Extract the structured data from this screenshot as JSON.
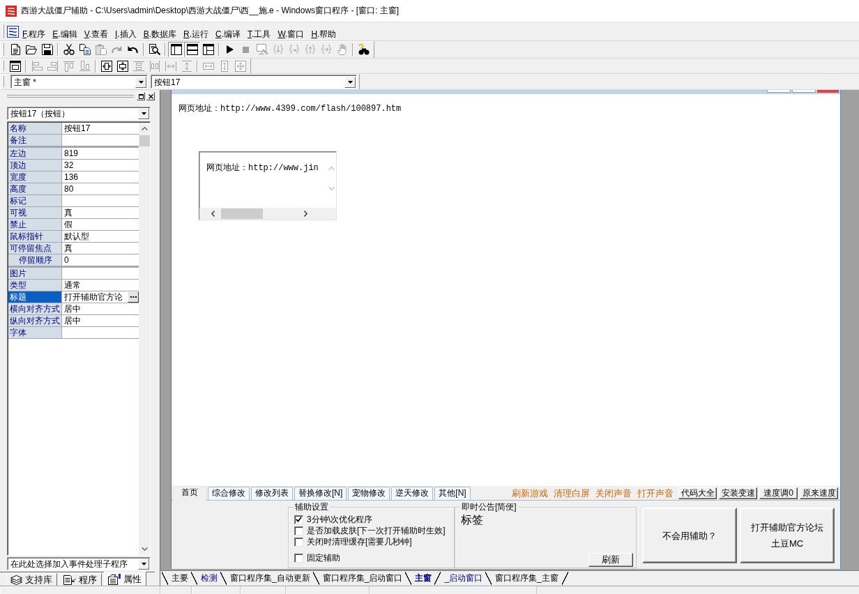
{
  "window": {
    "title": "西游大战僵尸辅助 - C:\\Users\\admin\\Desktop\\西游大战僵尸\\西__施.e - Windows窗口程序 - [窗口: 主窗]"
  },
  "menu": [
    "F.程序",
    "E.编辑",
    "V.查看",
    "I.插入",
    "B.数据库",
    "R.运行",
    "C.编译",
    "T.工具",
    "W.窗口",
    "H.帮助"
  ],
  "toolbars": [
    {
      "groups": [
        [
          {
            "kind": "new",
            "disabled": false,
            "pressed": false
          },
          {
            "kind": "open",
            "disabled": false,
            "pressed": false
          },
          {
            "kind": "save",
            "disabled": false,
            "pressed": false
          }
        ],
        [
          {
            "kind": "cut",
            "disabled": false,
            "pressed": false
          },
          {
            "kind": "copy",
            "disabled": false,
            "pressed": false
          },
          {
            "kind": "paste",
            "disabled": true,
            "pressed": false
          },
          {
            "kind": "redo",
            "disabled": true,
            "pressed": false
          },
          {
            "kind": "undo",
            "disabled": false,
            "pressed": false
          }
        ],
        [
          {
            "kind": "find",
            "disabled": false,
            "pressed": false
          }
        ],
        [
          {
            "kind": "layout-left",
            "disabled": false,
            "pressed": true
          },
          {
            "kind": "layout-top",
            "disabled": false,
            "pressed": true
          },
          {
            "kind": "layout-split",
            "disabled": false,
            "pressed": false
          }
        ],
        [
          {
            "kind": "run",
            "disabled": false,
            "pressed": false
          },
          {
            "kind": "stop",
            "disabled": true,
            "pressed": false
          },
          {
            "kind": "monitor",
            "disabled": true,
            "pressed": false
          },
          {
            "kind": "step-into",
            "disabled": true,
            "pressed": false
          },
          {
            "kind": "step-over",
            "disabled": true,
            "pressed": false
          },
          {
            "kind": "step-out",
            "disabled": true,
            "pressed": false
          },
          {
            "kind": "run-to",
            "disabled": true,
            "pressed": false
          },
          {
            "kind": "hand",
            "disabled": true,
            "pressed": false
          }
        ],
        [
          {
            "kind": "help",
            "disabled": false,
            "pressed": false
          }
        ]
      ]
    },
    {
      "groups": [
        [
          {
            "kind": "form",
            "disabled": false,
            "pressed": false
          }
        ],
        [
          {
            "kind": "align-left",
            "disabled": true,
            "pressed": false
          },
          {
            "kind": "align-right",
            "disabled": true,
            "pressed": false
          },
          {
            "kind": "align-top",
            "disabled": true,
            "pressed": false
          },
          {
            "kind": "align-bottom",
            "disabled": true,
            "pressed": false
          }
        ],
        [
          {
            "kind": "center-horizontal",
            "disabled": false,
            "pressed": false
          },
          {
            "kind": "center-vertical",
            "disabled": false,
            "pressed": false
          },
          {
            "kind": "stack-vertical",
            "disabled": true,
            "pressed": false
          },
          {
            "kind": "stack-horizontal",
            "disabled": true,
            "pressed": false
          },
          {
            "kind": "spread-horizontal",
            "disabled": true,
            "pressed": false
          },
          {
            "kind": "spread-vertical",
            "disabled": true,
            "pressed": false
          }
        ],
        [
          {
            "kind": "same-width",
            "disabled": true,
            "pressed": false
          },
          {
            "kind": "same-height",
            "disabled": true,
            "pressed": false
          },
          {
            "kind": "same-size",
            "disabled": true,
            "pressed": false
          }
        ]
      ]
    }
  ],
  "selectors": {
    "window_combo": "主窗 *",
    "control_combo": "按钮17"
  },
  "property_panel": {
    "object_combo": "按钮17（按钮）",
    "groups": [
      {
        "rows": [
          {
            "name": "名称",
            "value": "按钮17",
            "selected": false
          },
          {
            "name": "备注",
            "selected": false
          }
        ]
      },
      {
        "rows": [
          {
            "name": "左边",
            "value": "819",
            "selected": false
          },
          {
            "name": "顶边",
            "value": "32",
            "selected": false
          },
          {
            "name": "宽度",
            "value": "136",
            "selected": false
          },
          {
            "name": "高度",
            "value": "80",
            "selected": false
          },
          {
            "name": "标记",
            "selected": false
          },
          {
            "name": "可视",
            "value": "真",
            "selected": false
          },
          {
            "name": "禁止",
            "value": "假",
            "selected": false
          },
          {
            "name": "鼠标指针",
            "value": "默认型",
            "selected": false
          },
          {
            "name": "可停留焦点",
            "value": "真",
            "selected": false,
            "children": [
              {
                "name": "停留顺序",
                "value": "0",
                "selected": false
              }
            ]
          }
        ]
      },
      {
        "rows": [
          {
            "name": "图片",
            "selected": false
          },
          {
            "name": "类型",
            "value": "通常",
            "selected": false
          },
          {
            "name": "标题",
            "value": "打开辅助官方论",
            "selected": true
          },
          {
            "name": "横向对齐方式",
            "value": "居中",
            "selected": false
          },
          {
            "name": "纵向对齐方式",
            "value": "居中",
            "selected": false
          },
          {
            "name": "字体",
            "selected": false
          }
        ]
      }
    ],
    "event_combo": "在此处选择加入事件处理子程序",
    "tabs": [
      {
        "label": "支持库",
        "kind": "library",
        "selected": false
      },
      {
        "label": "程序",
        "kind": "program",
        "selected": false
      },
      {
        "label": "属性",
        "kind": "properties",
        "selected": true
      }
    ]
  },
  "designer": {
    "url_label": "网页地址：http://www.4399.com/flash/100897.htm",
    "text_box": {
      "text": "网页地址：http://www.jin"
    },
    "tabs": [
      {
        "label": "首页",
        "selected": true
      },
      {
        "label": "综合修改",
        "selected": false
      },
      {
        "label": "修改列表",
        "selected": false
      },
      {
        "label": "替换修改[N]",
        "selected": false
      },
      {
        "label": "宠物修改",
        "selected": false
      },
      {
        "label": "逆天修改",
        "selected": false
      },
      {
        "label": "其他[N]",
        "selected": false
      }
    ],
    "links": [
      "刷新游戏",
      "清理白屏",
      "关闭声音",
      "打开声音"
    ],
    "buttons": [
      "代码大全",
      "安装变速",
      "速度调0",
      "原来速度"
    ],
    "settings_group": {
      "title": "辅助设置",
      "options": [
        {
          "label": "3分钟\\次优化程序",
          "checked": true
        },
        {
          "label": "是否加载皮肤[下一次打开辅助时生效]",
          "checked": false
        },
        {
          "label": "关闭时清理缓存[需要几秒钟]",
          "checked": false
        },
        {
          "label": "固定辅助",
          "checked": false
        }
      ]
    },
    "notice_group": {
      "title": "即时公告[简便]",
      "label": "标签",
      "button": "刷新"
    },
    "big_buttons": [
      {
        "lines": [
          "不会用辅助？"
        ]
      },
      {
        "lines": [
          "打开辅助官方论坛",
          "土豆MC"
        ]
      }
    ]
  },
  "source_tabs": [
    {
      "label": "主要",
      "kind": "module",
      "selected": false
    },
    {
      "label": "检测",
      "kind": "window",
      "selected": false
    },
    {
      "label": "窗口程序集_自动更新",
      "kind": "module",
      "selected": false
    },
    {
      "label": "窗口程序集_启动窗口",
      "kind": "module",
      "selected": false
    },
    {
      "label": "主窗",
      "kind": "window",
      "selected": true
    },
    {
      "label": "_启动窗口",
      "kind": "window",
      "selected": false
    },
    {
      "label": "窗口程序集_主窗",
      "kind": "module",
      "selected": false
    }
  ]
}
